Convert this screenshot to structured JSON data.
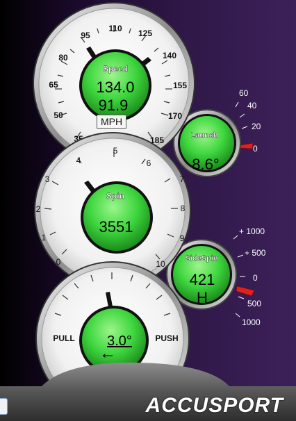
{
  "speed_gauge": {
    "title": "Speed",
    "value1": "134.0",
    "value2": "91.9",
    "unit_button": "MPH",
    "ticks": [
      "35",
      "50",
      "65",
      "80",
      "95",
      "110",
      "125",
      "140",
      "155",
      "170",
      "185"
    ]
  },
  "launch_gauge": {
    "title": "Launch",
    "value": "8.6°",
    "ticks": [
      "60",
      "40",
      "20",
      "0"
    ]
  },
  "spin_gauge": {
    "title": "Spin",
    "value": "3551",
    "ticks": [
      "0",
      "1",
      "2",
      "3",
      "4",
      "5",
      "6",
      "7",
      "8",
      "9",
      "10"
    ]
  },
  "sidespin_gauge": {
    "title": "SideSpin",
    "value": "421",
    "direction": "H",
    "ticks": [
      "+ 1000",
      "+ 500",
      "0",
      "500",
      "1000"
    ]
  },
  "path_gauge": {
    "left_label": "PULL",
    "right_label": "PUSH",
    "value": "3.0°",
    "arrow": "←"
  },
  "brand": "ACCUSPORT",
  "colors": {
    "green": "#3ed63e",
    "needle_red": "#e0201a",
    "background": "#2f1747"
  }
}
